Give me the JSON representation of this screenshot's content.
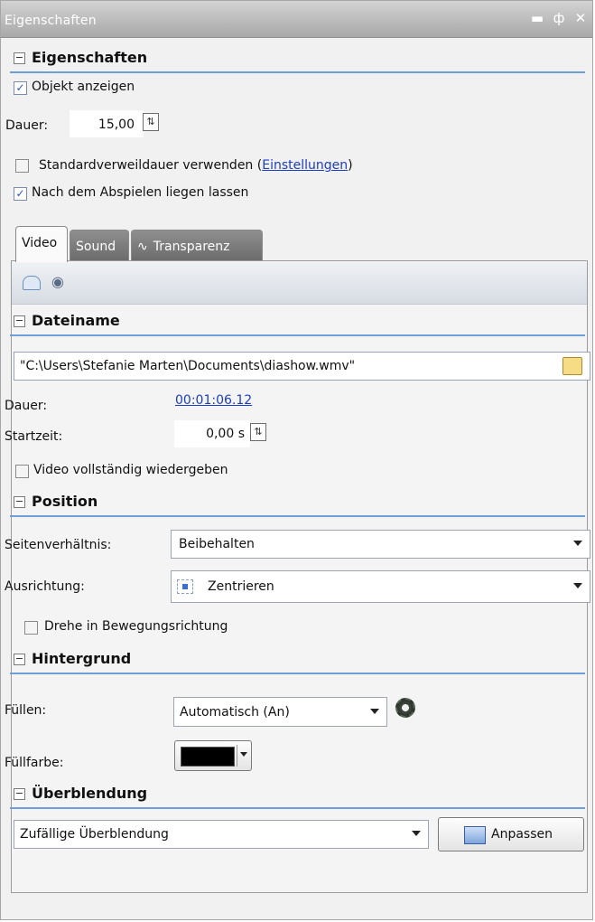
{
  "window": {
    "title": "Eigenschaften",
    "controls": [
      "minimize-icon",
      "pin-icon",
      "close-icon"
    ]
  },
  "eigenschaften": {
    "heading": "Eigenschaften",
    "show_object": {
      "label": "Objekt anzeigen",
      "checked": true
    },
    "duration_label": "Dauer:",
    "duration_value": "15,00",
    "standard_dwell": {
      "label_prefix": "Standardverweildauer verwenden (",
      "link": "Einstellungen",
      "label_suffix": ")",
      "checked": false
    },
    "keep_after_play": {
      "label": "Nach dem Abspielen liegen lassen",
      "checked": true
    }
  },
  "tabs": [
    {
      "label": "Video",
      "active": true
    },
    {
      "label": "Sound",
      "active": false
    },
    {
      "label": "Transparenz",
      "active": false
    }
  ],
  "dateiname": {
    "heading": "Dateiname",
    "path": "\"C:\\Users\\Stefanie Marten\\Documents\\diashow.wmv\"",
    "duration_label": "Dauer:",
    "duration_value": "00:01:06.12",
    "start_label": "Startzeit:",
    "start_value": "0,00 s",
    "play_full": {
      "label": "Video vollständig wiedergeben",
      "checked": false
    }
  },
  "position": {
    "heading": "Position",
    "aspect_label": "Seitenverhältnis:",
    "aspect_value": "Beibehalten",
    "align_label": "Ausrichtung:",
    "align_value": "Zentrieren",
    "rotate": {
      "label": "Drehe in Bewegungsrichtung",
      "checked": false
    }
  },
  "hintergrund": {
    "heading": "Hintergrund",
    "fill_label": "Füllen:",
    "fill_value": "Automatisch (An)",
    "fillcolor_label": "Füllfarbe:",
    "fillcolor": "#000000"
  },
  "ueberblendung": {
    "heading": "Überblendung",
    "value": "Zufällige Überblendung",
    "adjust_button": "Anpassen"
  },
  "colors": {
    "accent": "#6f9fd8",
    "link": "#1d3fbf"
  }
}
